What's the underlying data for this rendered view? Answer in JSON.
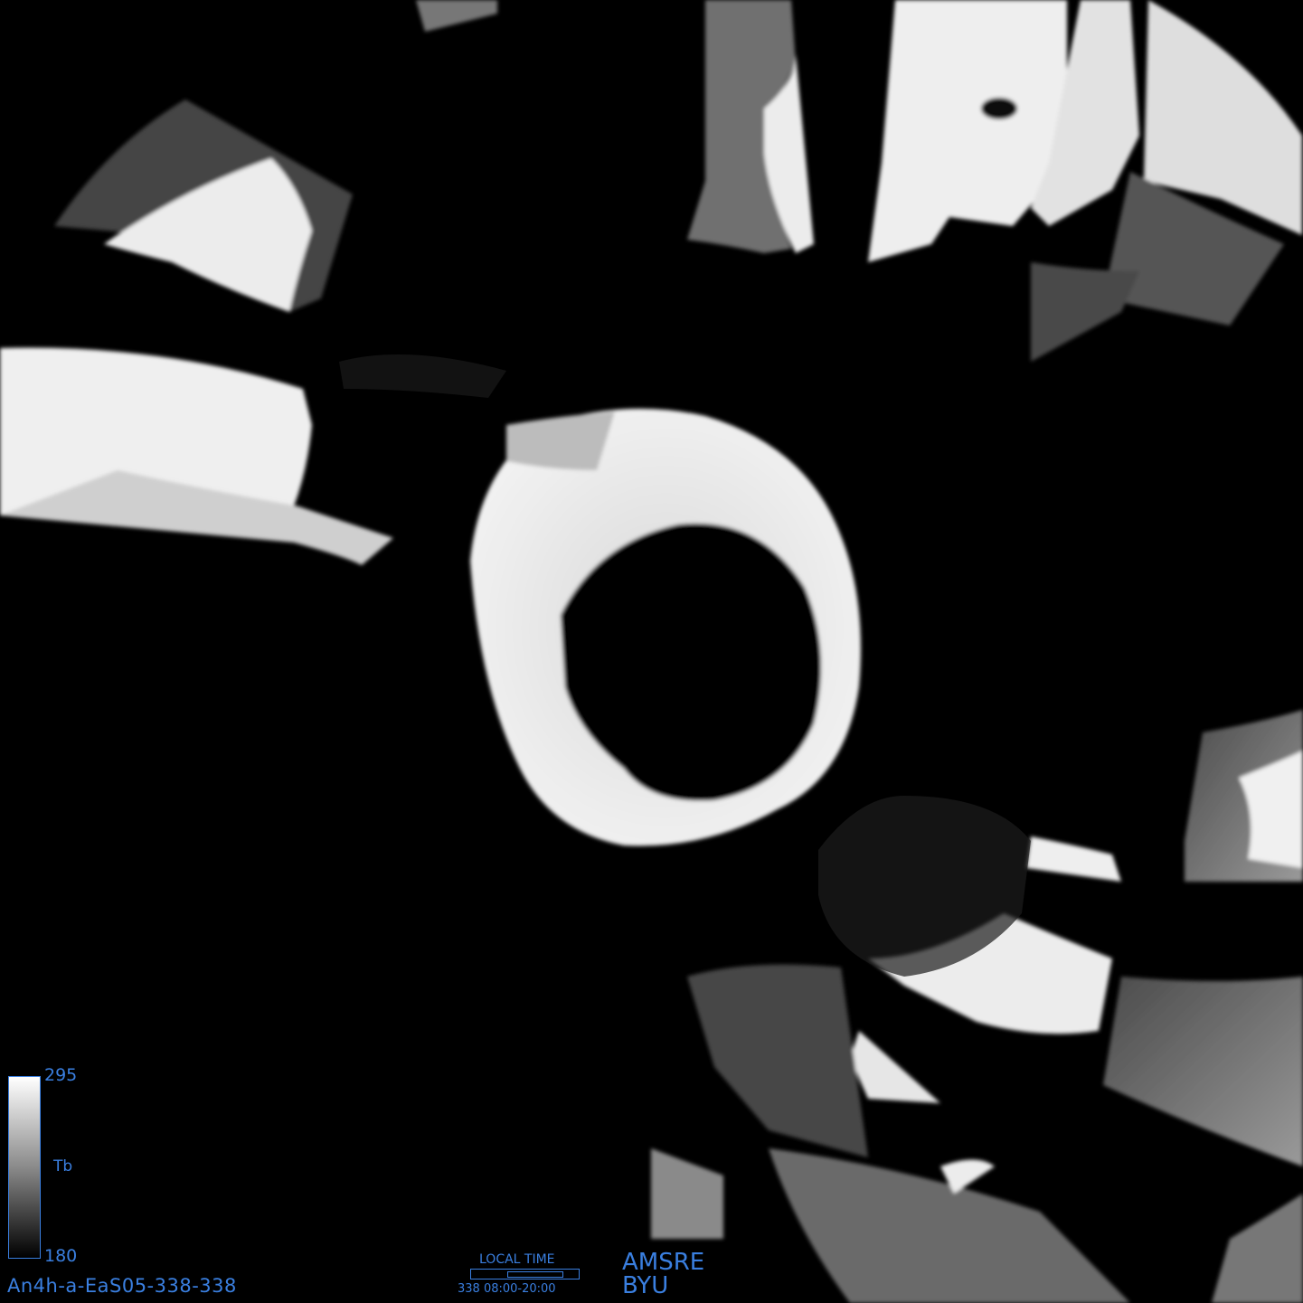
{
  "image": {
    "subject": "polar stereographic brightness temperature mosaic, south pole",
    "colors": {
      "background": "#000000",
      "annotation": "#3a7fe0",
      "ice_bright": "#f2f2f2",
      "ice_dim": "#9a9a9a"
    }
  },
  "legend": {
    "max_value": "295",
    "min_value": "180",
    "variable": "Tb",
    "fill_fraction": 1.0
  },
  "product": {
    "id": "An4h-a-EaS05-338-338"
  },
  "local_time": {
    "title": "LOCAL TIME",
    "range": "338 08:00-20:00"
  },
  "credit": {
    "sensor": "AMSRE",
    "organization": "BYU"
  }
}
